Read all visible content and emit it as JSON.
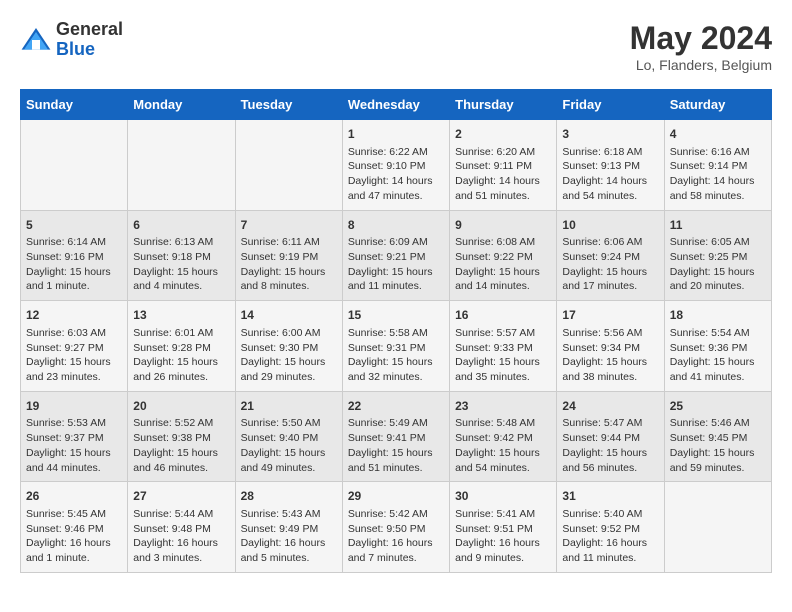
{
  "header": {
    "logo": {
      "general": "General",
      "blue": "Blue"
    },
    "title": "May 2024",
    "location": "Lo, Flanders, Belgium"
  },
  "calendar": {
    "days_of_week": [
      "Sunday",
      "Monday",
      "Tuesday",
      "Wednesday",
      "Thursday",
      "Friday",
      "Saturday"
    ],
    "weeks": [
      [
        {
          "day": "",
          "info": ""
        },
        {
          "day": "",
          "info": ""
        },
        {
          "day": "",
          "info": ""
        },
        {
          "day": "1",
          "info": "Sunrise: 6:22 AM\nSunset: 9:10 PM\nDaylight: 14 hours and 47 minutes."
        },
        {
          "day": "2",
          "info": "Sunrise: 6:20 AM\nSunset: 9:11 PM\nDaylight: 14 hours and 51 minutes."
        },
        {
          "day": "3",
          "info": "Sunrise: 6:18 AM\nSunset: 9:13 PM\nDaylight: 14 hours and 54 minutes."
        },
        {
          "day": "4",
          "info": "Sunrise: 6:16 AM\nSunset: 9:14 PM\nDaylight: 14 hours and 58 minutes."
        }
      ],
      [
        {
          "day": "5",
          "info": "Sunrise: 6:14 AM\nSunset: 9:16 PM\nDaylight: 15 hours and 1 minute."
        },
        {
          "day": "6",
          "info": "Sunrise: 6:13 AM\nSunset: 9:18 PM\nDaylight: 15 hours and 4 minutes."
        },
        {
          "day": "7",
          "info": "Sunrise: 6:11 AM\nSunset: 9:19 PM\nDaylight: 15 hours and 8 minutes."
        },
        {
          "day": "8",
          "info": "Sunrise: 6:09 AM\nSunset: 9:21 PM\nDaylight: 15 hours and 11 minutes."
        },
        {
          "day": "9",
          "info": "Sunrise: 6:08 AM\nSunset: 9:22 PM\nDaylight: 15 hours and 14 minutes."
        },
        {
          "day": "10",
          "info": "Sunrise: 6:06 AM\nSunset: 9:24 PM\nDaylight: 15 hours and 17 minutes."
        },
        {
          "day": "11",
          "info": "Sunrise: 6:05 AM\nSunset: 9:25 PM\nDaylight: 15 hours and 20 minutes."
        }
      ],
      [
        {
          "day": "12",
          "info": "Sunrise: 6:03 AM\nSunset: 9:27 PM\nDaylight: 15 hours and 23 minutes."
        },
        {
          "day": "13",
          "info": "Sunrise: 6:01 AM\nSunset: 9:28 PM\nDaylight: 15 hours and 26 minutes."
        },
        {
          "day": "14",
          "info": "Sunrise: 6:00 AM\nSunset: 9:30 PM\nDaylight: 15 hours and 29 minutes."
        },
        {
          "day": "15",
          "info": "Sunrise: 5:58 AM\nSunset: 9:31 PM\nDaylight: 15 hours and 32 minutes."
        },
        {
          "day": "16",
          "info": "Sunrise: 5:57 AM\nSunset: 9:33 PM\nDaylight: 15 hours and 35 minutes."
        },
        {
          "day": "17",
          "info": "Sunrise: 5:56 AM\nSunset: 9:34 PM\nDaylight: 15 hours and 38 minutes."
        },
        {
          "day": "18",
          "info": "Sunrise: 5:54 AM\nSunset: 9:36 PM\nDaylight: 15 hours and 41 minutes."
        }
      ],
      [
        {
          "day": "19",
          "info": "Sunrise: 5:53 AM\nSunset: 9:37 PM\nDaylight: 15 hours and 44 minutes."
        },
        {
          "day": "20",
          "info": "Sunrise: 5:52 AM\nSunset: 9:38 PM\nDaylight: 15 hours and 46 minutes."
        },
        {
          "day": "21",
          "info": "Sunrise: 5:50 AM\nSunset: 9:40 PM\nDaylight: 15 hours and 49 minutes."
        },
        {
          "day": "22",
          "info": "Sunrise: 5:49 AM\nSunset: 9:41 PM\nDaylight: 15 hours and 51 minutes."
        },
        {
          "day": "23",
          "info": "Sunrise: 5:48 AM\nSunset: 9:42 PM\nDaylight: 15 hours and 54 minutes."
        },
        {
          "day": "24",
          "info": "Sunrise: 5:47 AM\nSunset: 9:44 PM\nDaylight: 15 hours and 56 minutes."
        },
        {
          "day": "25",
          "info": "Sunrise: 5:46 AM\nSunset: 9:45 PM\nDaylight: 15 hours and 59 minutes."
        }
      ],
      [
        {
          "day": "26",
          "info": "Sunrise: 5:45 AM\nSunset: 9:46 PM\nDaylight: 16 hours and 1 minute."
        },
        {
          "day": "27",
          "info": "Sunrise: 5:44 AM\nSunset: 9:48 PM\nDaylight: 16 hours and 3 minutes."
        },
        {
          "day": "28",
          "info": "Sunrise: 5:43 AM\nSunset: 9:49 PM\nDaylight: 16 hours and 5 minutes."
        },
        {
          "day": "29",
          "info": "Sunrise: 5:42 AM\nSunset: 9:50 PM\nDaylight: 16 hours and 7 minutes."
        },
        {
          "day": "30",
          "info": "Sunrise: 5:41 AM\nSunset: 9:51 PM\nDaylight: 16 hours and 9 minutes."
        },
        {
          "day": "31",
          "info": "Sunrise: 5:40 AM\nSunset: 9:52 PM\nDaylight: 16 hours and 11 minutes."
        },
        {
          "day": "",
          "info": ""
        }
      ]
    ]
  }
}
